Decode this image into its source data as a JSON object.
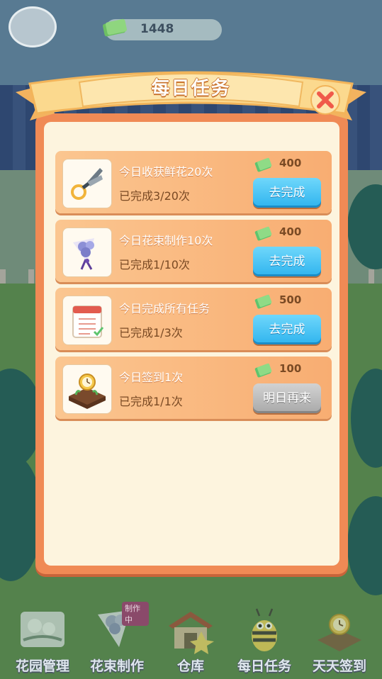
{
  "hud": {
    "cash_value": "1448"
  },
  "dialog": {
    "title": "每日任务",
    "close_label": "×"
  },
  "tasks": [
    {
      "title": "今日收获鲜花20次",
      "progress": "已完成3/20次",
      "reward": "400",
      "button": "去完成",
      "button_state": "active",
      "icon": "pruning-shears-icon"
    },
    {
      "title": "今日花束制作10次",
      "progress": "已完成1/10次",
      "reward": "400",
      "button": "去完成",
      "button_state": "active",
      "icon": "flower-bouquet-icon"
    },
    {
      "title": "今日完成所有任务",
      "progress": "已完成1/3次",
      "reward": "500",
      "button": "去完成",
      "button_state": "active",
      "icon": "checklist-calendar-icon"
    },
    {
      "title": "今日签到1次",
      "progress": "已完成1/1次",
      "reward": "100",
      "button": "明日再来",
      "button_state": "disabled",
      "icon": "sprout-pocketwatch-icon"
    }
  ],
  "nav": {
    "items": [
      {
        "label": "花园管理",
        "icon": "garden-icon"
      },
      {
        "label": "花束制作",
        "icon": "bouquet-icon",
        "badge": "制作中"
      },
      {
        "label": "仓库",
        "icon": "warehouse-icon"
      },
      {
        "label": "每日任务",
        "icon": "bee-icon"
      },
      {
        "label": "天天签到",
        "icon": "checkin-watch-icon"
      }
    ]
  },
  "colors": {
    "dialog_border": "#f08a55",
    "dialog_fill": "#fdf4de",
    "card_fill": "#f8ad72",
    "button_blue": "#2fb4ee",
    "button_gray": "#a9a9a9",
    "reward_green": "#5dc46e"
  }
}
